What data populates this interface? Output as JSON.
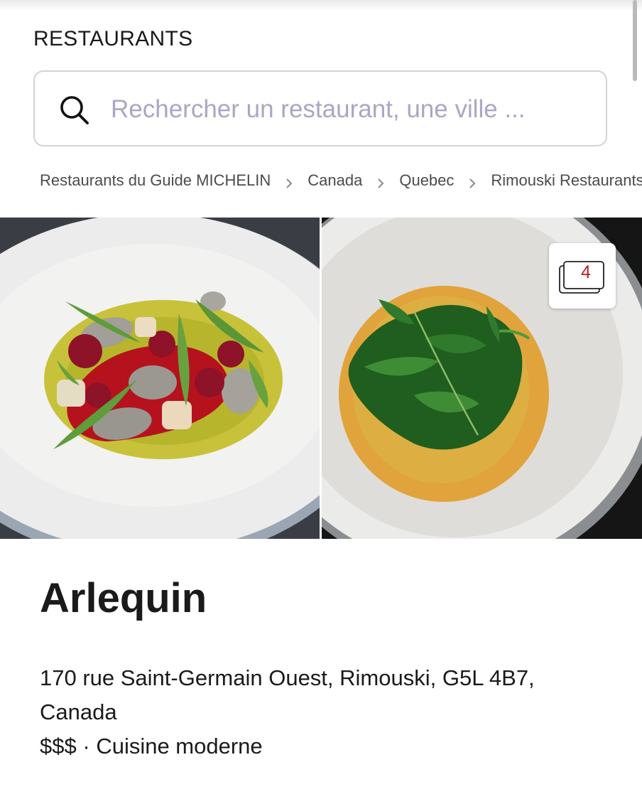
{
  "header": {
    "title": "RESTAURANTS"
  },
  "search": {
    "placeholder": "Rechercher un restaurant, une ville ...",
    "icon": "search-icon"
  },
  "breadcrumb": [
    {
      "label": "Restaurants du Guide MICHELIN"
    },
    {
      "label": "Canada"
    },
    {
      "label": "Quebec"
    },
    {
      "label": "Rimouski Restaurants"
    }
  ],
  "gallery": {
    "photo_count": "4",
    "count_color": "#b2202c",
    "icon": "photo-stack-icon"
  },
  "restaurant": {
    "name": "Arlequin",
    "address": "170 rue Saint-Germain Ouest, Rimouski, G5L 4B7, Canada",
    "price": "$$$",
    "separator": "·",
    "cuisine": "Cuisine moderne"
  }
}
